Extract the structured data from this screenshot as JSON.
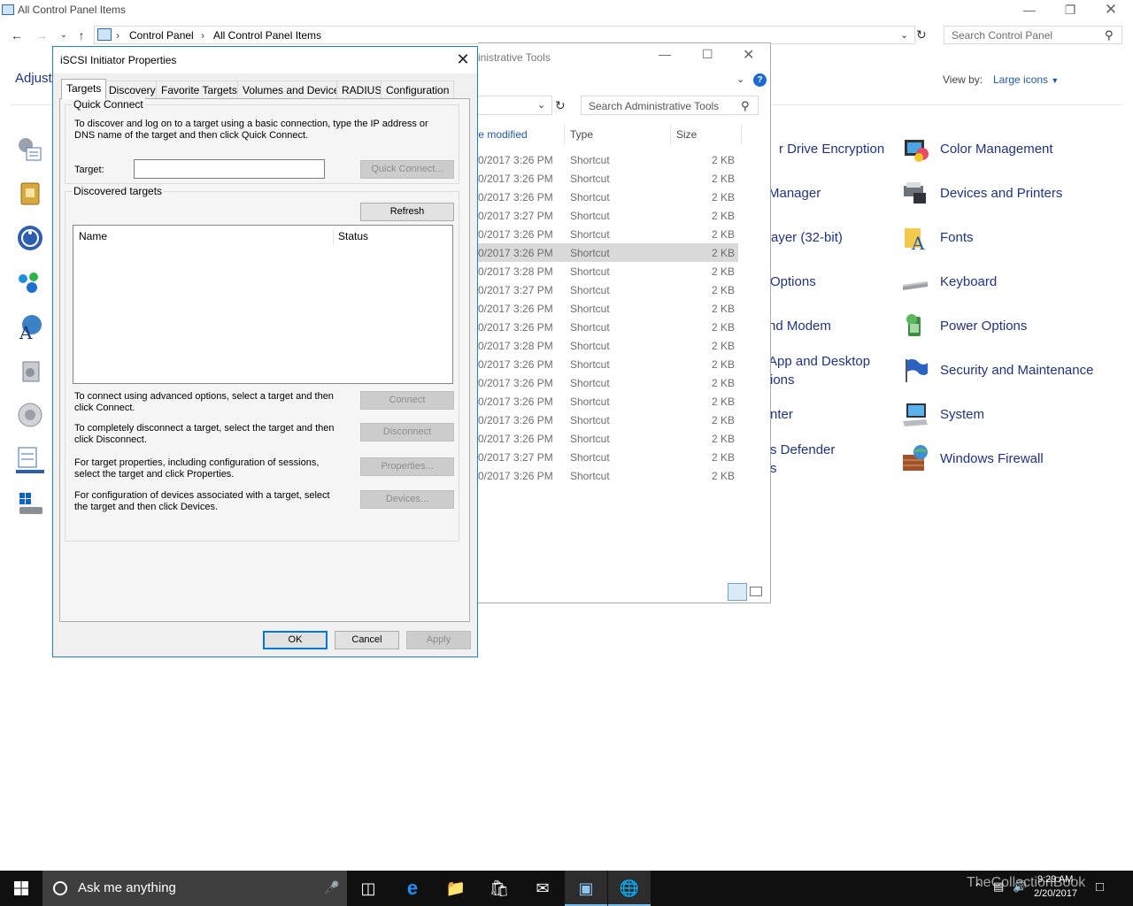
{
  "main_window": {
    "title": "All Control Panel Items",
    "breadcrumb": [
      "Control Panel",
      "All Control Panel Items"
    ],
    "search_placeholder": "Search Control Panel",
    "heading_partial": "Adjust",
    "view_by_label": "View by:",
    "view_by_value": "Large icons"
  },
  "control_panel_items_middle": [
    "r Drive Encryption",
    "Manager",
    "ayer (32-bit)",
    "Options",
    "nd Modem",
    "App and Desktop",
    "ions",
    "nter",
    "s Defender",
    "s"
  ],
  "control_panel_items_right": [
    {
      "label": "Color Management",
      "icon": "color-management-icon"
    },
    {
      "label": "Devices and Printers",
      "icon": "devices-printers-icon"
    },
    {
      "label": "Fonts",
      "icon": "fonts-icon"
    },
    {
      "label": "Keyboard",
      "icon": "keyboard-icon"
    },
    {
      "label": "Power Options",
      "icon": "power-options-icon"
    },
    {
      "label": "Security and Maintenance",
      "icon": "security-flag-icon"
    },
    {
      "label": "System",
      "icon": "system-icon"
    },
    {
      "label": "Windows Firewall",
      "icon": "firewall-icon"
    }
  ],
  "admin_window": {
    "title_partial": "inistrative Tools",
    "search_placeholder": "Search Administrative Tools",
    "columns": {
      "date": "te modified",
      "type": "Type",
      "size": "Size"
    },
    "rows": [
      {
        "date": "0/2017 3:26 PM",
        "type": "Shortcut",
        "size": "2 KB"
      },
      {
        "date": "0/2017 3:26 PM",
        "type": "Shortcut",
        "size": "2 KB"
      },
      {
        "date": "0/2017 3:26 PM",
        "type": "Shortcut",
        "size": "2 KB"
      },
      {
        "date": "0/2017 3:27 PM",
        "type": "Shortcut",
        "size": "2 KB"
      },
      {
        "date": "0/2017 3:26 PM",
        "type": "Shortcut",
        "size": "2 KB"
      },
      {
        "date": "0/2017 3:26 PM",
        "type": "Shortcut",
        "size": "2 KB"
      },
      {
        "date": "0/2017 3:28 PM",
        "type": "Shortcut",
        "size": "2 KB"
      },
      {
        "date": "0/2017 3:27 PM",
        "type": "Shortcut",
        "size": "2 KB"
      },
      {
        "date": "0/2017 3:26 PM",
        "type": "Shortcut",
        "size": "2 KB"
      },
      {
        "date": "0/2017 3:26 PM",
        "type": "Shortcut",
        "size": "2 KB"
      },
      {
        "date": "0/2017 3:28 PM",
        "type": "Shortcut",
        "size": "2 KB"
      },
      {
        "date": "0/2017 3:26 PM",
        "type": "Shortcut",
        "size": "2 KB"
      },
      {
        "date": "0/2017 3:26 PM",
        "type": "Shortcut",
        "size": "2 KB"
      },
      {
        "date": "0/2017 3:26 PM",
        "type": "Shortcut",
        "size": "2 KB"
      },
      {
        "date": "0/2017 3:26 PM",
        "type": "Shortcut",
        "size": "2 KB"
      },
      {
        "date": "0/2017 3:26 PM",
        "type": "Shortcut",
        "size": "2 KB"
      },
      {
        "date": "0/2017 3:27 PM",
        "type": "Shortcut",
        "size": "2 KB"
      },
      {
        "date": "0/2017 3:26 PM",
        "type": "Shortcut",
        "size": "2 KB"
      }
    ],
    "selected_row": 5
  },
  "dialog": {
    "title": "iSCSI Initiator Properties",
    "tabs": [
      "Targets",
      "Discovery",
      "Favorite Targets",
      "Volumes and Devices",
      "RADIUS",
      "Configuration"
    ],
    "active_tab": 0,
    "quick_connect": {
      "group_label": "Quick Connect",
      "description": "To discover and log on to a target using a basic connection, type the IP address or DNS name of the target and then click Quick Connect.",
      "target_label": "Target:",
      "target_value": "",
      "button": "Quick Connect..."
    },
    "discovered": {
      "group_label": "Discovered targets",
      "refresh_button": "Refresh",
      "columns": [
        "Name",
        "Status"
      ],
      "actions": [
        {
          "text": "To connect using advanced options, select a target and then click Connect.",
          "button": "Connect"
        },
        {
          "text": "To completely disconnect a target, select the target and then click Disconnect.",
          "button": "Disconnect"
        },
        {
          "text": "For target properties, including configuration of sessions, select the target and click Properties.",
          "button": "Properties..."
        },
        {
          "text": "For configuration of devices associated with a target, select the target and then click Devices.",
          "button": "Devices..."
        }
      ]
    },
    "buttons": {
      "ok": "OK",
      "cancel": "Cancel",
      "apply": "Apply"
    }
  },
  "taskbar": {
    "search_text": "Ask me anything",
    "time": "9:29 AM",
    "date": "2/20/2017",
    "watermark": "TheCollectionBook"
  },
  "colors": {
    "link_blue": "#1e3287",
    "accent": "#0078d7",
    "taskbar": "#101010"
  }
}
